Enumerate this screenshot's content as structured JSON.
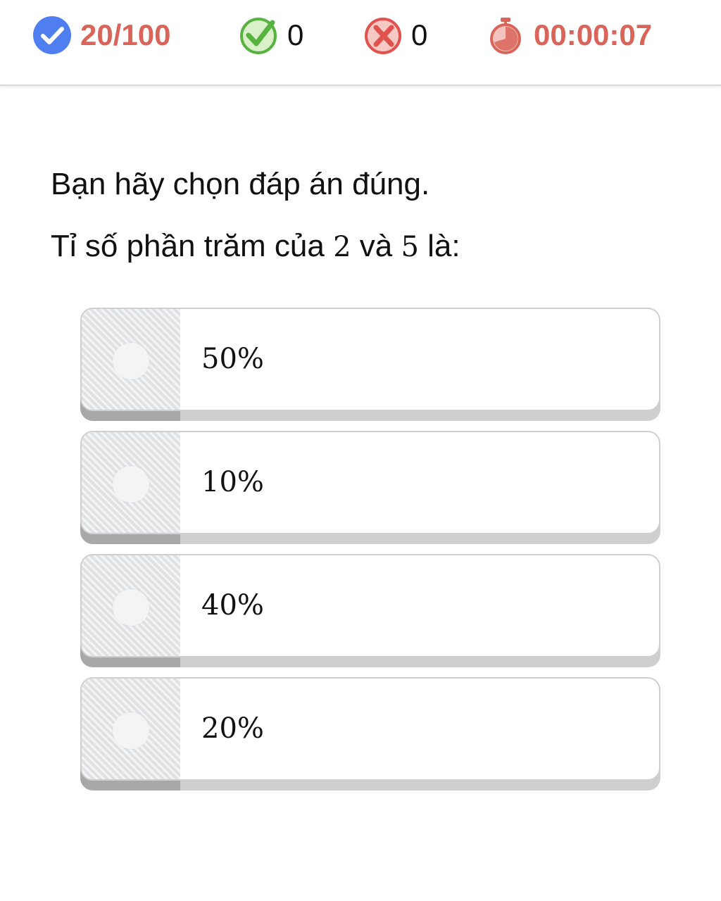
{
  "status": {
    "progress": "20/100",
    "correct_count": "0",
    "wrong_count": "0",
    "timer": "00:00:07",
    "icons": {
      "progress": "check-circle-blue-icon",
      "correct": "check-green-icon",
      "wrong": "cross-red-icon",
      "timer": "stopwatch-icon"
    },
    "colors": {
      "accent": "#d9655a",
      "progress_icon": "#4f7ef0",
      "correct_icon": "#57b23f",
      "wrong_icon": "#e0524d"
    }
  },
  "question": {
    "instruction": "Bạn hãy chọn đáp án đúng.",
    "prompt_before": "Tỉ số phần trăm của ",
    "num_a": "2",
    "prompt_middle": " và ",
    "num_b": "5",
    "prompt_after": " là:"
  },
  "options": [
    {
      "label": "50%"
    },
    {
      "label": "10%"
    },
    {
      "label": "40%"
    },
    {
      "label": "20%"
    }
  ]
}
